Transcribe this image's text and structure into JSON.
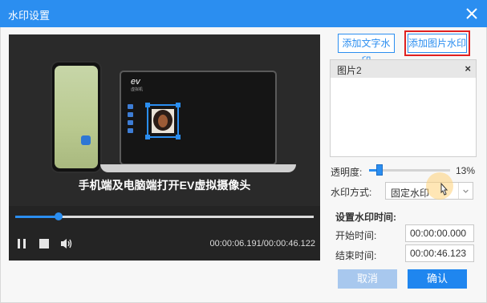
{
  "window": {
    "title": "水印设置"
  },
  "video": {
    "caption": "手机端及电脑端打开EV虚拟摄像头",
    "laptop_logo": "ev",
    "laptop_sub": "虚拟机",
    "timecode": "00:00:06.191/00:00:46.122",
    "progress_fraction": 0.145
  },
  "toolbar": {
    "add_text_label": "添加文字水印",
    "add_image_label": "添加图片水印"
  },
  "watermark_list": {
    "items": [
      {
        "label": "图片2"
      }
    ]
  },
  "opacity": {
    "label": "透明度:",
    "value_text": "13%",
    "value": 0.13
  },
  "mode": {
    "label": "水印方式:",
    "value": "固定水印"
  },
  "time": {
    "section_label": "设置水印时间:",
    "start_label": "开始时间:",
    "start_value": "00:00:00.000",
    "end_label": "结束时间:",
    "end_value": "00:00:46.123"
  },
  "actions": {
    "cancel_label": "取消",
    "ok_label": "确认"
  },
  "colors": {
    "accent": "#2b8ef0",
    "selected_outline": "#e02020"
  }
}
